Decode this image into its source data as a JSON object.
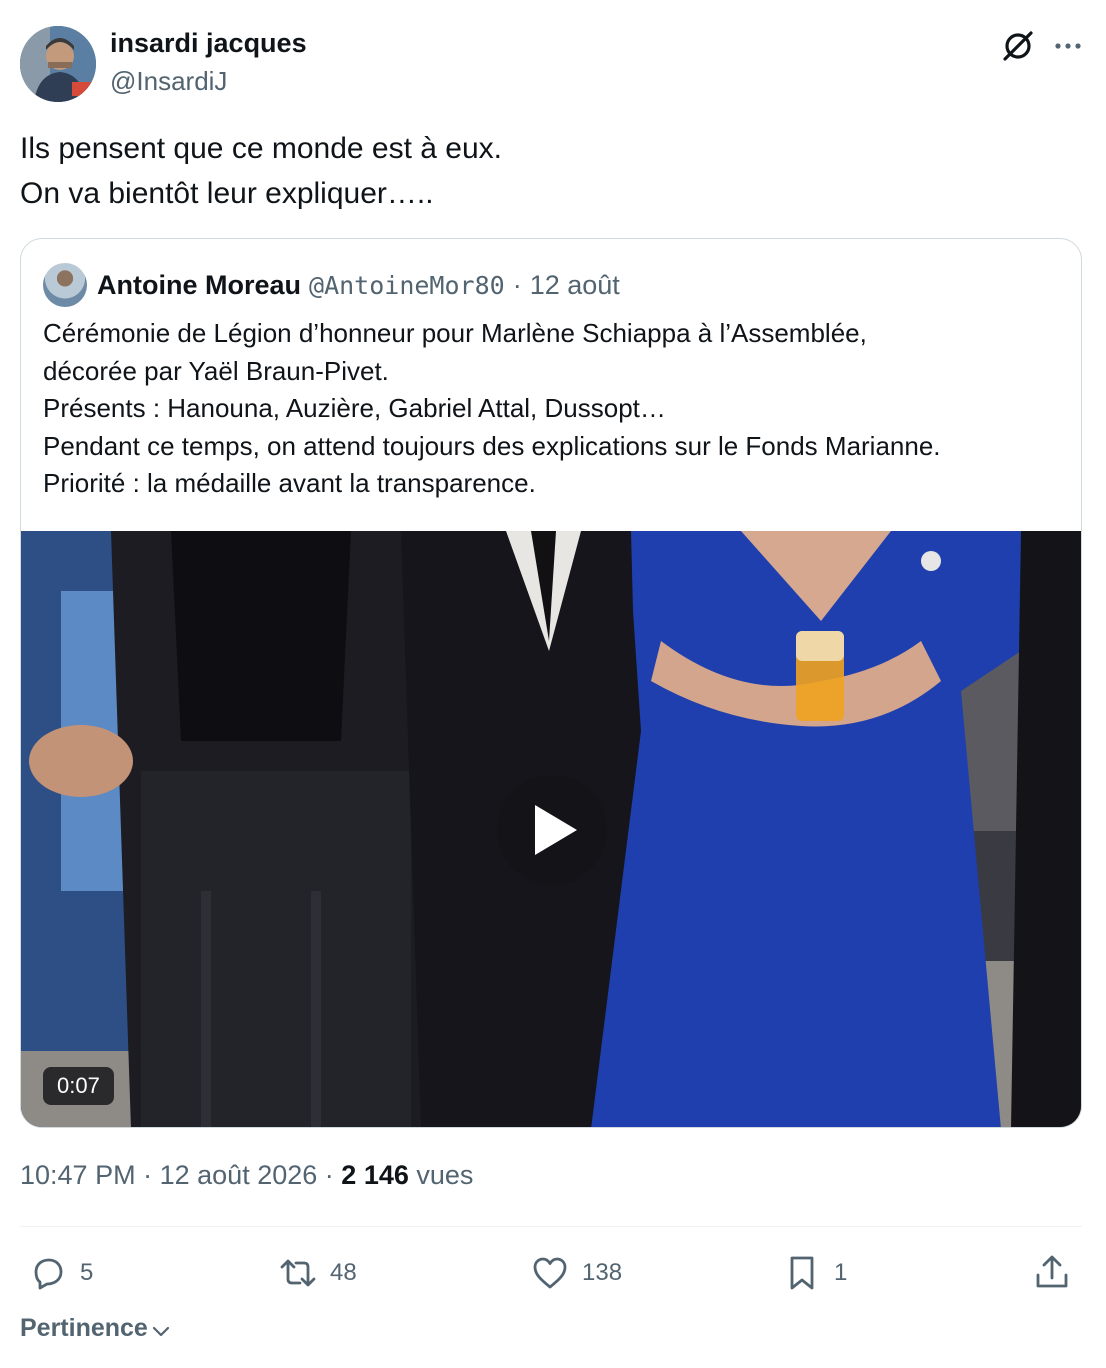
{
  "author": {
    "name": "insardi jacques",
    "handle": "@InsardiJ",
    "avatar_icon": "avatar"
  },
  "header_icons": [
    "grok-icon",
    "more-icon"
  ],
  "tweet": {
    "lines": [
      "Ils pensent que ce monde est à eux.",
      "On va bientôt leur expliquer….."
    ]
  },
  "quote": {
    "name": "Antoine Moreau",
    "handle": "@AntoineMor80",
    "separator": "·",
    "date": "12 août",
    "lines": [
      "Cérémonie de Légion d’honneur pour Marlène Schiappa à l’Assemblée,",
      "décorée par Yaël Braun-Pivet.",
      "Présents : Hanouna, Auzière, Gabriel Attal, Dussopt…",
      "Pendant ce temps, on attend toujours des explications sur le Fonds Marianne.",
      "Priorité : la médaille avant la transparence."
    ],
    "video": {
      "duration": "0:07",
      "play_icon": "play-icon",
      "dress_color": "#1f3fae"
    }
  },
  "meta": {
    "time": "10:47 PM",
    "separator": "·",
    "date": "12 août 2026",
    "separator2": "·",
    "views_count": "2 146",
    "views_label": "vues"
  },
  "actions": {
    "replies": "5",
    "reposts": "48",
    "likes": "138",
    "bookmarks": "1"
  },
  "sort": {
    "label": "Pertinence"
  },
  "colors": {
    "text": "#0f1419",
    "secondary": "#536471",
    "border": "#cfd9de"
  }
}
